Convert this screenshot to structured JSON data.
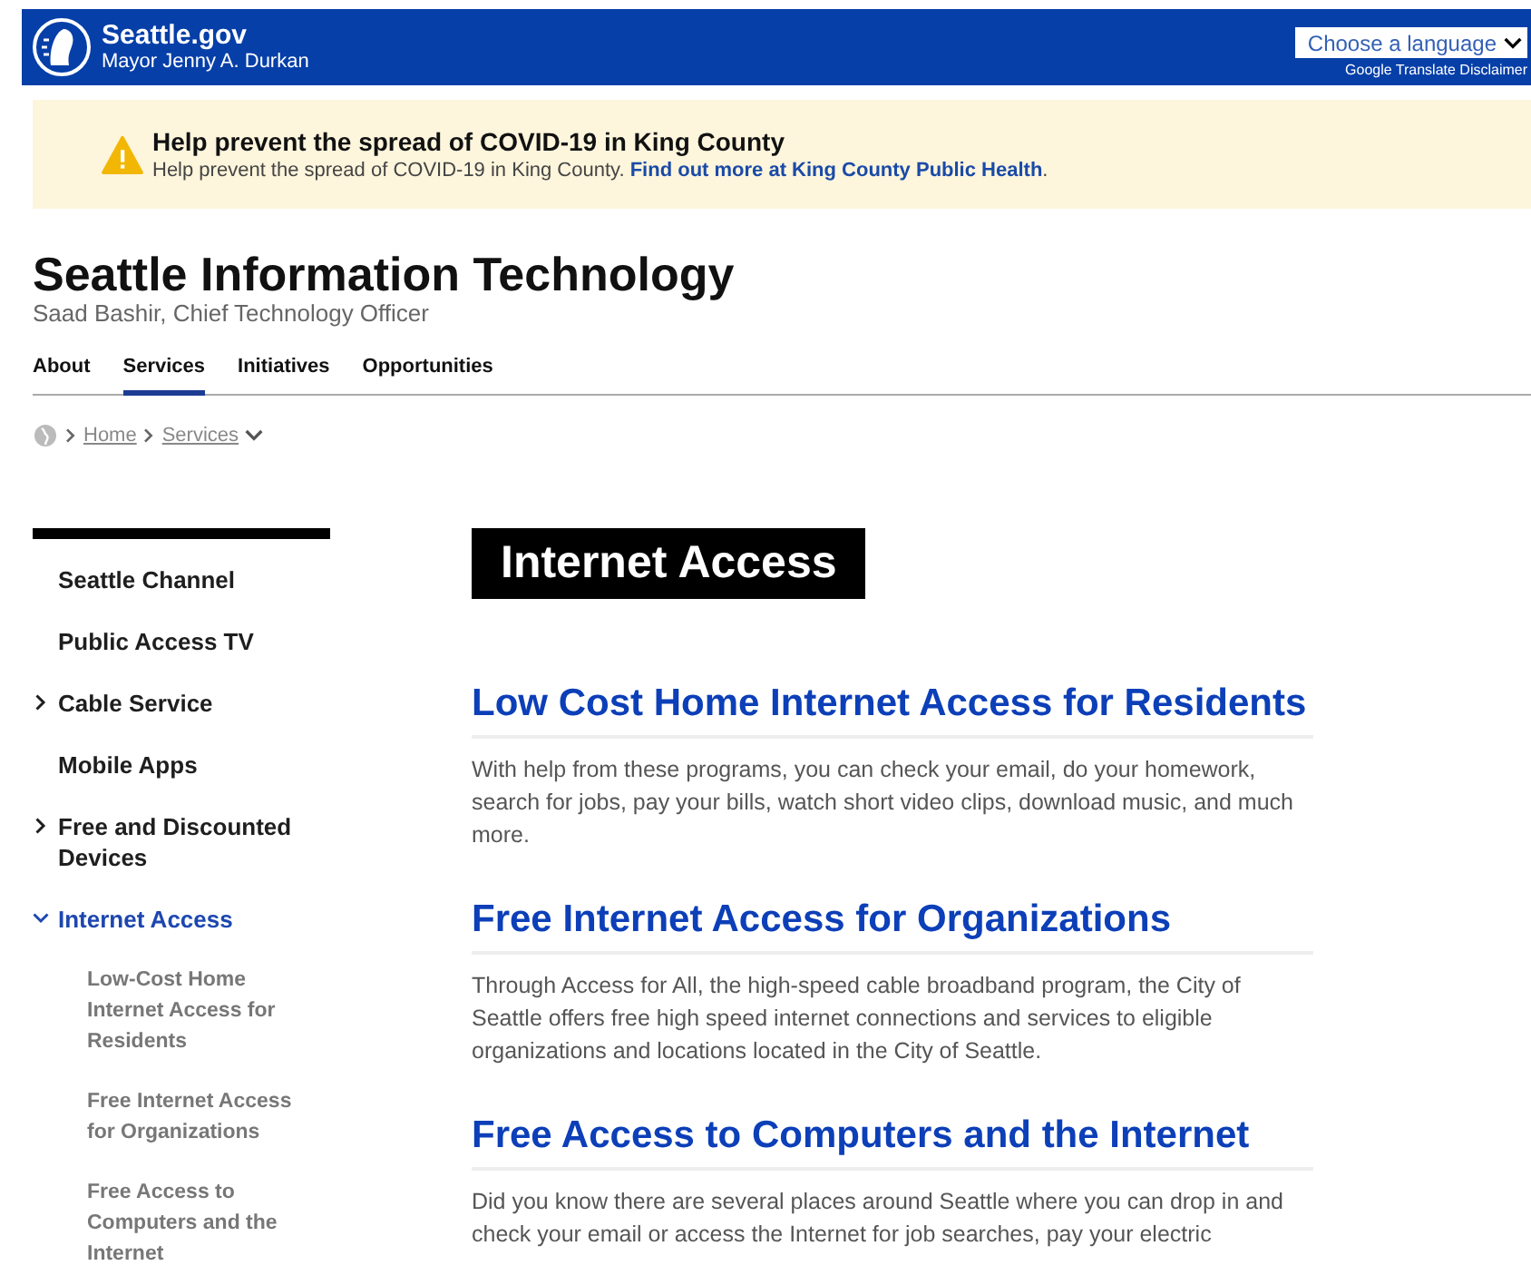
{
  "header": {
    "site": "Seattle.gov",
    "subtitle": "Mayor Jenny A. Durkan",
    "language_select": {
      "value": "Choose a language"
    },
    "disclaimer_link": "Google Translate Disclaimer"
  },
  "alert": {
    "title": "Help prevent the spread of COVID-19 in King County",
    "text": "Help prevent the spread of COVID-19 in King County. ",
    "link": "Find out more at King County Public Health",
    "end": "."
  },
  "department": {
    "title": "Seattle Information Technology",
    "subtitle": "Saad Bashir, Chief Technology Officer"
  },
  "nav": [
    {
      "label": "About",
      "selected": false
    },
    {
      "label": "Services",
      "selected": true
    },
    {
      "label": "Initiatives",
      "selected": false
    },
    {
      "label": "Opportunities",
      "selected": false
    }
  ],
  "breadcrumb": {
    "items": [
      "Home",
      "Services"
    ]
  },
  "sidebar": {
    "items": [
      {
        "label": "Seattle Channel",
        "kind": "link",
        "selected": false
      },
      {
        "label": "Public Access TV",
        "kind": "link",
        "selected": false
      },
      {
        "label": "Cable Service",
        "kind": "expandable",
        "expanded": false,
        "selected": false
      },
      {
        "label": "Mobile Apps",
        "kind": "link",
        "selected": false
      },
      {
        "label": "Free and Discounted Devices",
        "kind": "expandable",
        "expanded": false,
        "selected": false
      },
      {
        "label": "Internet Access",
        "kind": "expandable",
        "expanded": true,
        "selected": true,
        "children": [
          {
            "label": "Low-Cost Home Internet Access for Residents"
          },
          {
            "label": "Free Internet Access for Organizations"
          },
          {
            "label": "Free Access to Computers and the Internet"
          }
        ]
      }
    ]
  },
  "main": {
    "title": "Internet Access",
    "sections": [
      {
        "heading": "Low Cost Home Internet Access for Residents",
        "text": "With help from these programs, you can check your email, do your homework, search for jobs, pay your bills, watch short video clips, download music, and much more."
      },
      {
        "heading": "Free Internet Access for Organizations",
        "text": "Through Access for All, the high-speed cable broadband program, the City of Seattle offers free high speed internet connections and services to eligible organizations and locations located in the City of Seattle."
      },
      {
        "heading": "Free Access to Computers and the Internet",
        "text": "Did you know there are several places around Seattle where you can drop in and check your email or access the Internet for job searches, pay your electric"
      }
    ]
  }
}
